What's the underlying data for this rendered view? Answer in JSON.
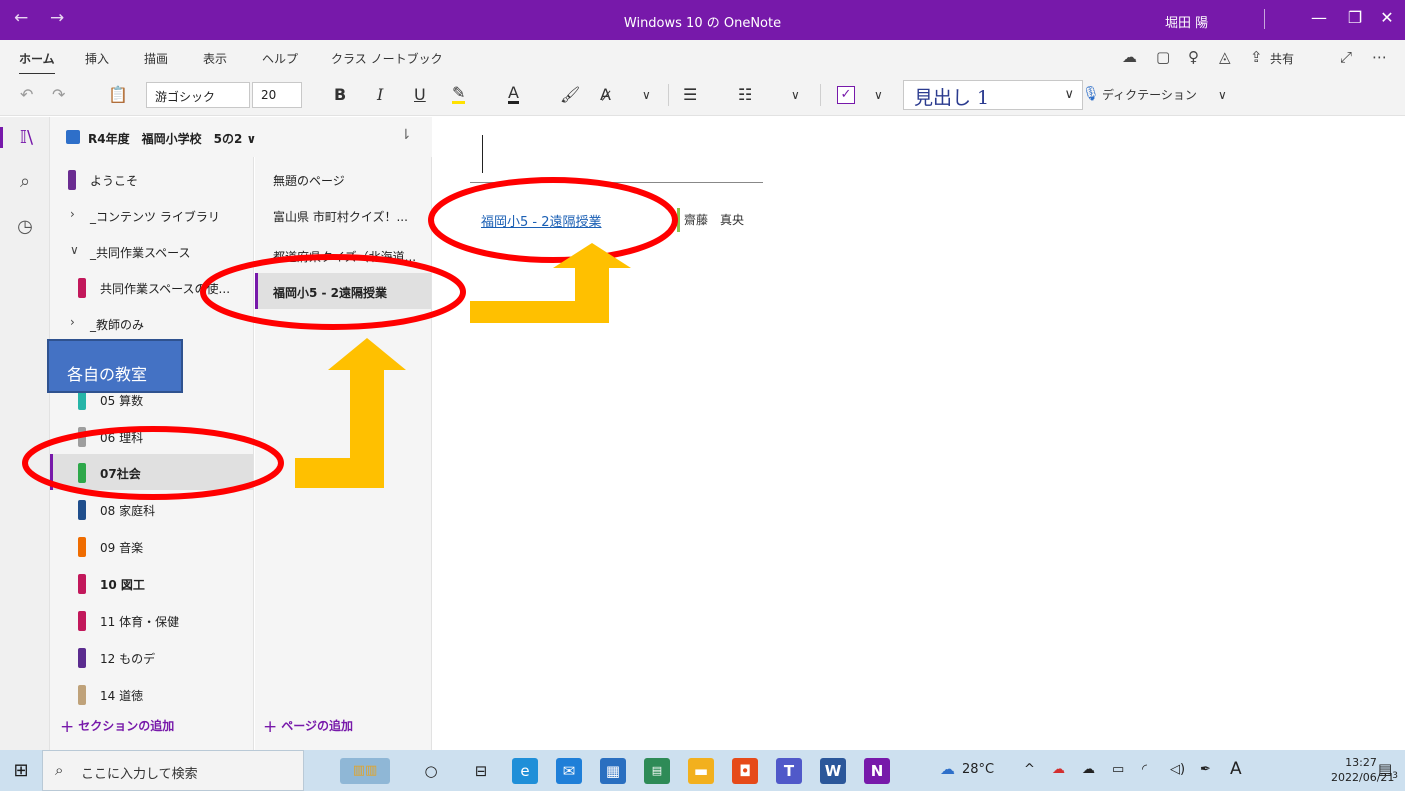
{
  "window": {
    "title": "Windows 10 の OneNote",
    "user": "堀田 陽"
  },
  "menu": {
    "tabs": [
      "ホーム",
      "挿入",
      "描画",
      "表示",
      "ヘルプ",
      "クラス ノートブック"
    ],
    "share_label": "共有"
  },
  "ribbon": {
    "font_name": "游ゴシック",
    "font_size": "20",
    "bold": "B",
    "italic": "I",
    "underline": "U",
    "font_color": "A",
    "style_name": "見出し 1",
    "dictation_label": "ディクテーション"
  },
  "notebook": {
    "title": "R4年度　福岡小学校　5の2"
  },
  "sections": [
    {
      "label": "ようこそ",
      "color": "#6a2c91"
    },
    {
      "label": "_コンテンツ ライブラリ",
      "expand": "collapsed"
    },
    {
      "label": "_共同作業スペース",
      "expand": "expanded"
    },
    {
      "label": "共同作業スペースの使...",
      "color": "#c2185b"
    },
    {
      "label": "_教師のみ",
      "expand": "collapsed"
    },
    {
      "label": "05 算数",
      "color": "#26b5a8"
    },
    {
      "label": "06 理科",
      "color": "#9e9e9e"
    },
    {
      "label": "07社会",
      "color": "#2ea84a"
    },
    {
      "label": "08 家庭科",
      "color": "#1f4e8c"
    },
    {
      "label": "09 音楽",
      "color": "#ef6c00"
    },
    {
      "label": "10 図工",
      "color": "#c2185b"
    },
    {
      "label": "11 体育・保健",
      "color": "#c2185b"
    },
    {
      "label": "12 ものデ",
      "color": "#5b2c8f"
    },
    {
      "label": "14 道徳",
      "color": "#bfa27a"
    }
  ],
  "pages": [
    {
      "label": "無題のページ"
    },
    {
      "label": "富山県 市町村クイズ！..."
    },
    {
      "label": "都道府県クイズ（北海道..."
    },
    {
      "label": "福岡小5 - 2遠隔授業"
    }
  ],
  "add_section_label": "セクションの追加",
  "add_page_label": "ページの追加",
  "canvas": {
    "link_text": "福岡小5 - 2遠隔授業",
    "author": "齋藤　真央"
  },
  "callout": {
    "text": "各自の教室"
  },
  "taskbar": {
    "search_placeholder": "ここに入力して検索",
    "temperature": "28°C",
    "ime": "A",
    "time": "13:27",
    "date": "2022/06/21",
    "notifications": "3"
  },
  "colors": {
    "accent": "#7719aa",
    "annotation_red": "#ff0000",
    "annotation_arrow": "#ffc000",
    "callout_fill": "#4472c4"
  }
}
